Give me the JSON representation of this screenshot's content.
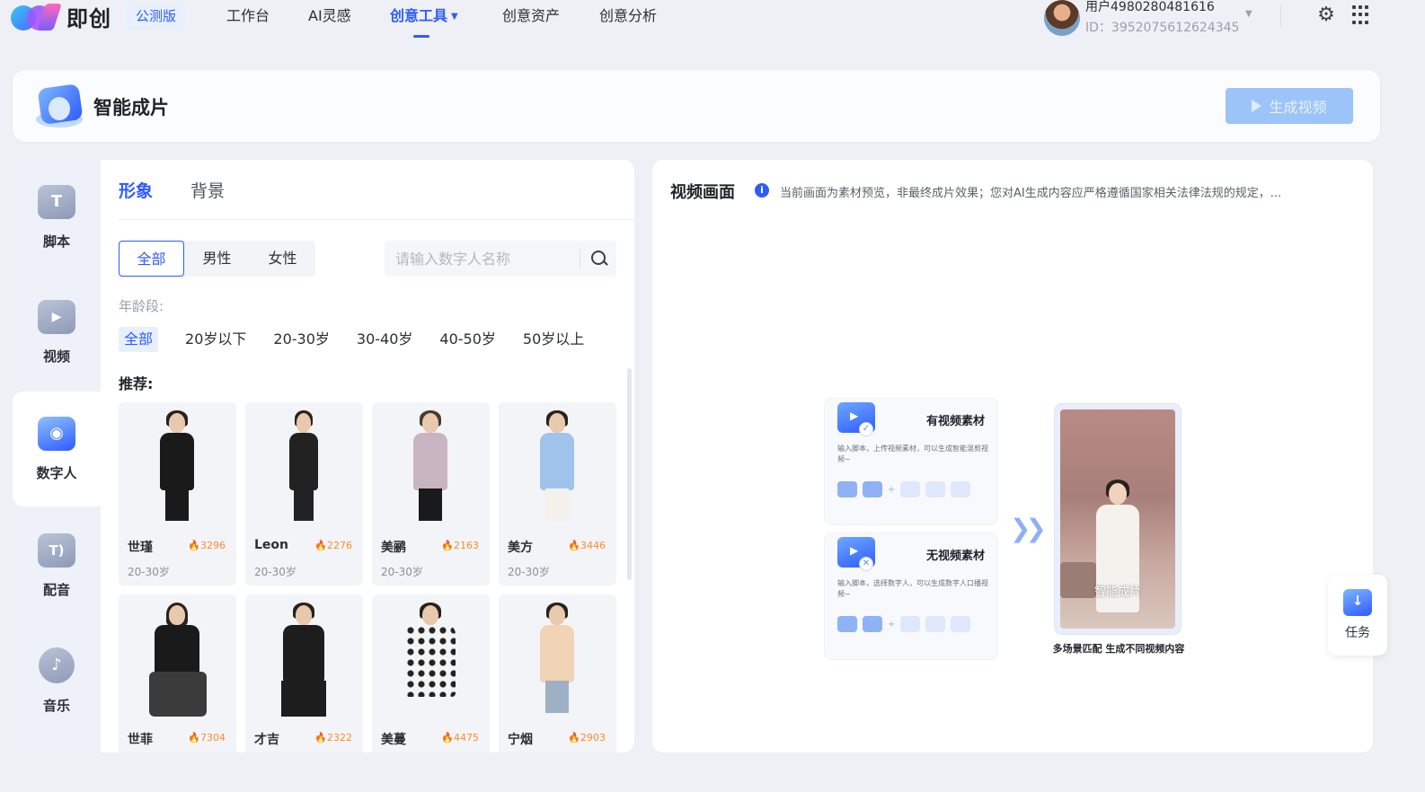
{
  "app": {
    "logo_text": "即创",
    "beta_badge": "公测版"
  },
  "nav": {
    "items": [
      {
        "label": "工作台"
      },
      {
        "label": "AI灵感"
      },
      {
        "label": "创意工具",
        "active": true
      },
      {
        "label": "创意资产"
      },
      {
        "label": "创意分析"
      }
    ]
  },
  "user": {
    "name": "用户4980280481616",
    "id": "ID：3952075612624345"
  },
  "header": {
    "title": "智能成片",
    "generate_button": "生成视频"
  },
  "sidebar": {
    "items": [
      {
        "label": "脚本",
        "icon": "script-icon"
      },
      {
        "label": "视频",
        "icon": "video-icon"
      },
      {
        "label": "数字人",
        "icon": "digital-human-icon",
        "active": true
      },
      {
        "label": "配音",
        "icon": "voiceover-icon"
      },
      {
        "label": "音乐",
        "icon": "music-icon"
      }
    ]
  },
  "panel": {
    "tabs": [
      {
        "label": "形象",
        "active": true
      },
      {
        "label": "背景"
      }
    ],
    "gender_filters": [
      {
        "label": "全部",
        "active": true
      },
      {
        "label": "男性"
      },
      {
        "label": "女性"
      }
    ],
    "search_placeholder": "请输入数字人名称",
    "age_label": "年龄段:",
    "age_filters": [
      {
        "label": "全部",
        "active": true
      },
      {
        "label": "20岁以下"
      },
      {
        "label": "20-30岁"
      },
      {
        "label": "30-40岁"
      },
      {
        "label": "40-50岁"
      },
      {
        "label": "50岁以上"
      }
    ],
    "recommend_label": "推荐:",
    "avatars": [
      {
        "name": "世瑾",
        "heat": "3296",
        "age": "20-30岁"
      },
      {
        "name": "Leon",
        "heat": "2276",
        "age": "20-30岁"
      },
      {
        "name": "美鹂",
        "heat": "2163",
        "age": "20-30岁"
      },
      {
        "name": "美方",
        "heat": "3446",
        "age": "20-30岁"
      },
      {
        "name": "世菲",
        "heat": "7304",
        "age": ""
      },
      {
        "name": "才吉",
        "heat": "2322",
        "age": ""
      },
      {
        "name": "美蔓",
        "heat": "4475",
        "age": ""
      },
      {
        "name": "宁烟",
        "heat": "2903",
        "age": ""
      }
    ]
  },
  "preview": {
    "title": "视频画面",
    "notice": "当前画面为素材预览，非最终成片效果；您对AI生成内容应严格遵循国家相关法律法规的规定，...",
    "flow": {
      "with_video_title": "有视频素材",
      "with_video_desc": "输入脚本，上传视频素材，可以生成智能混剪视频~",
      "without_video_title": "无视频素材",
      "without_video_desc": "输入脚本，选择数字人，可以生成数字人口播视频~",
      "preview_caption": "智能成片",
      "preview_label": "多场景匹配 生成不同视频内容"
    }
  },
  "task_button": {
    "label": "任务"
  }
}
